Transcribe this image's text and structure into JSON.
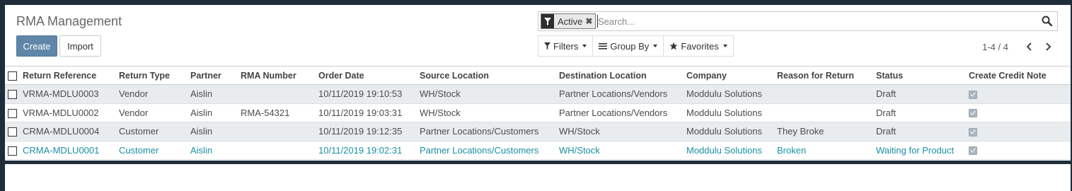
{
  "header": {
    "title": "RMA Management",
    "create_label": "Create",
    "import_label": "Import"
  },
  "search": {
    "facet_label": "Active",
    "facet_remove": "✖",
    "placeholder": "Search..."
  },
  "filters": {
    "filters_label": "Filters",
    "groupby_label": "Group By",
    "favorites_label": "Favorites"
  },
  "pager": {
    "value": "1-4 / 4"
  },
  "table": {
    "columns": [
      "Return Reference",
      "Return Type",
      "Partner",
      "RMA Number",
      "Order Date",
      "Source Location",
      "Destination Location",
      "Company",
      "Reason for Return",
      "Status",
      "Create Credit Note"
    ],
    "rows": [
      [
        "VRMA-MDLU0003",
        "Vendor",
        "Aislin",
        "",
        "10/11/2019 19:10:53",
        "WH/Stock",
        "Partner Locations/Vendors",
        "Moddulu Solutions",
        "",
        "Draft"
      ],
      [
        "VRMA-MDLU0002",
        "Vendor",
        "Aislin",
        "RMA-54321",
        "10/11/2019 19:03:31",
        "WH/Stock",
        "Partner Locations/Vendors",
        "Moddulu Solutions",
        "",
        "Draft"
      ],
      [
        "CRMA-MDLU0004",
        "Customer",
        "Aislin",
        "",
        "10/11/2019 19:12:35",
        "Partner Locations/Customers",
        "WH/Stock",
        "Moddulu Solutions",
        "They Broke",
        "Draft"
      ],
      [
        "CRMA-MDLU0001",
        "Customer",
        "Aislin",
        "",
        "10/11/2019 19:02:31",
        "Partner Locations/Customers",
        "WH/Stock",
        "Moddulu Solutions",
        "Broken",
        "Waiting for Product"
      ]
    ]
  },
  "colors": {
    "accent": "#5f86a8",
    "link_row": "#1a8fa6",
    "background": "#1f2d3a"
  }
}
